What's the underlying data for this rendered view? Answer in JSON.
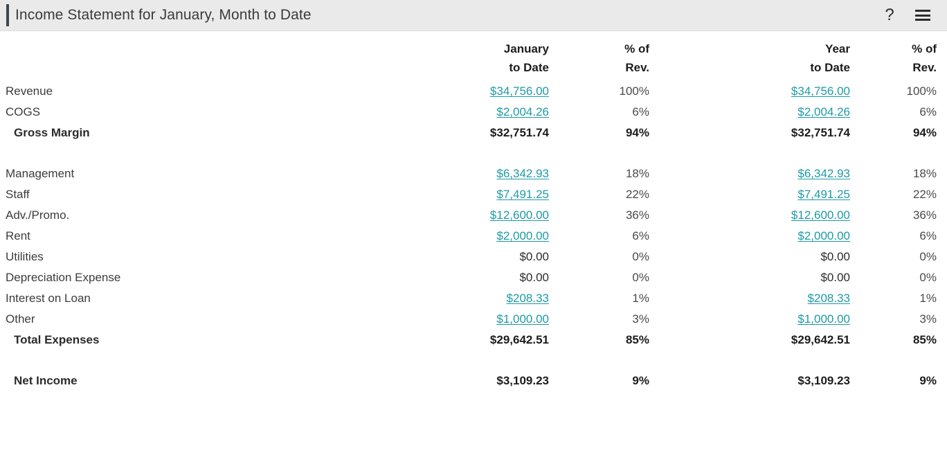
{
  "header": {
    "title": "Income Statement for January, Month to Date",
    "help_icon": "question-mark-help-icon",
    "menu_icon": "hamburger-menu-icon",
    "accent_color": "#3d4650",
    "background_color": "#eaeaea"
  },
  "theme": {
    "link_color": "#1d9aa6",
    "text_color": "#3c3c3c",
    "bold_text_color": "#1c1c1c"
  },
  "table": {
    "columns": [
      {
        "key": "label",
        "line1": "",
        "line2": "",
        "align": "left"
      },
      {
        "key": "mtd_amount",
        "line1": "January",
        "line2": "to Date",
        "align": "right"
      },
      {
        "key": "mtd_pct",
        "line1": "% of",
        "line2": "Rev.",
        "align": "right"
      },
      {
        "key": "ytd_amount",
        "line1": "Year",
        "line2": "to Date",
        "align": "right"
      },
      {
        "key": "ytd_pct",
        "line1": "% of",
        "line2": "Rev.",
        "align": "right"
      }
    ],
    "rows": [
      {
        "type": "item",
        "label": "Revenue",
        "mtd_amount": "$34,756.00",
        "mtd_amount_link": true,
        "mtd_pct": "100%",
        "ytd_amount": "$34,756.00",
        "ytd_amount_link": true,
        "ytd_pct": "100%"
      },
      {
        "type": "item",
        "label": "COGS",
        "mtd_amount": "$2,004.26",
        "mtd_amount_link": true,
        "mtd_pct": "6%",
        "ytd_amount": "$2,004.26",
        "ytd_amount_link": true,
        "ytd_pct": "6%"
      },
      {
        "type": "total",
        "label": "Gross Margin",
        "mtd_amount": "$32,751.74",
        "mtd_amount_link": false,
        "mtd_pct": "94%",
        "ytd_amount": "$32,751.74",
        "ytd_amount_link": false,
        "ytd_pct": "94%"
      },
      {
        "type": "spacer"
      },
      {
        "type": "item",
        "label": "Management",
        "mtd_amount": "$6,342.93",
        "mtd_amount_link": true,
        "mtd_pct": "18%",
        "ytd_amount": "$6,342.93",
        "ytd_amount_link": true,
        "ytd_pct": "18%"
      },
      {
        "type": "item",
        "label": "Staff",
        "mtd_amount": "$7,491.25",
        "mtd_amount_link": true,
        "mtd_pct": "22%",
        "ytd_amount": "$7,491.25",
        "ytd_amount_link": true,
        "ytd_pct": "22%"
      },
      {
        "type": "item",
        "label": "Adv./Promo.",
        "mtd_amount": "$12,600.00",
        "mtd_amount_link": true,
        "mtd_pct": "36%",
        "ytd_amount": "$12,600.00",
        "ytd_amount_link": true,
        "ytd_pct": "36%"
      },
      {
        "type": "item",
        "label": "Rent",
        "mtd_amount": "$2,000.00",
        "mtd_amount_link": true,
        "mtd_pct": "6%",
        "ytd_amount": "$2,000.00",
        "ytd_amount_link": true,
        "ytd_pct": "6%"
      },
      {
        "type": "item",
        "label": "Utilities",
        "mtd_amount": "$0.00",
        "mtd_amount_link": false,
        "mtd_pct": "0%",
        "ytd_amount": "$0.00",
        "ytd_amount_link": false,
        "ytd_pct": "0%"
      },
      {
        "type": "item",
        "label": "Depreciation Expense",
        "mtd_amount": "$0.00",
        "mtd_amount_link": false,
        "mtd_pct": "0%",
        "ytd_amount": "$0.00",
        "ytd_amount_link": false,
        "ytd_pct": "0%"
      },
      {
        "type": "item",
        "label": "Interest on Loan",
        "mtd_amount": "$208.33",
        "mtd_amount_link": true,
        "mtd_pct": "1%",
        "ytd_amount": "$208.33",
        "ytd_amount_link": true,
        "ytd_pct": "1%"
      },
      {
        "type": "item",
        "label": "Other",
        "mtd_amount": "$1,000.00",
        "mtd_amount_link": true,
        "mtd_pct": "3%",
        "ytd_amount": "$1,000.00",
        "ytd_amount_link": true,
        "ytd_pct": "3%"
      },
      {
        "type": "total",
        "label": "Total Expenses",
        "mtd_amount": "$29,642.51",
        "mtd_amount_link": false,
        "mtd_pct": "85%",
        "ytd_amount": "$29,642.51",
        "ytd_amount_link": false,
        "ytd_pct": "85%"
      },
      {
        "type": "spacer"
      },
      {
        "type": "total",
        "label": "Net Income",
        "mtd_amount": "$3,109.23",
        "mtd_amount_link": false,
        "mtd_pct": "9%",
        "ytd_amount": "$3,109.23",
        "ytd_amount_link": false,
        "ytd_pct": "9%"
      }
    ]
  }
}
